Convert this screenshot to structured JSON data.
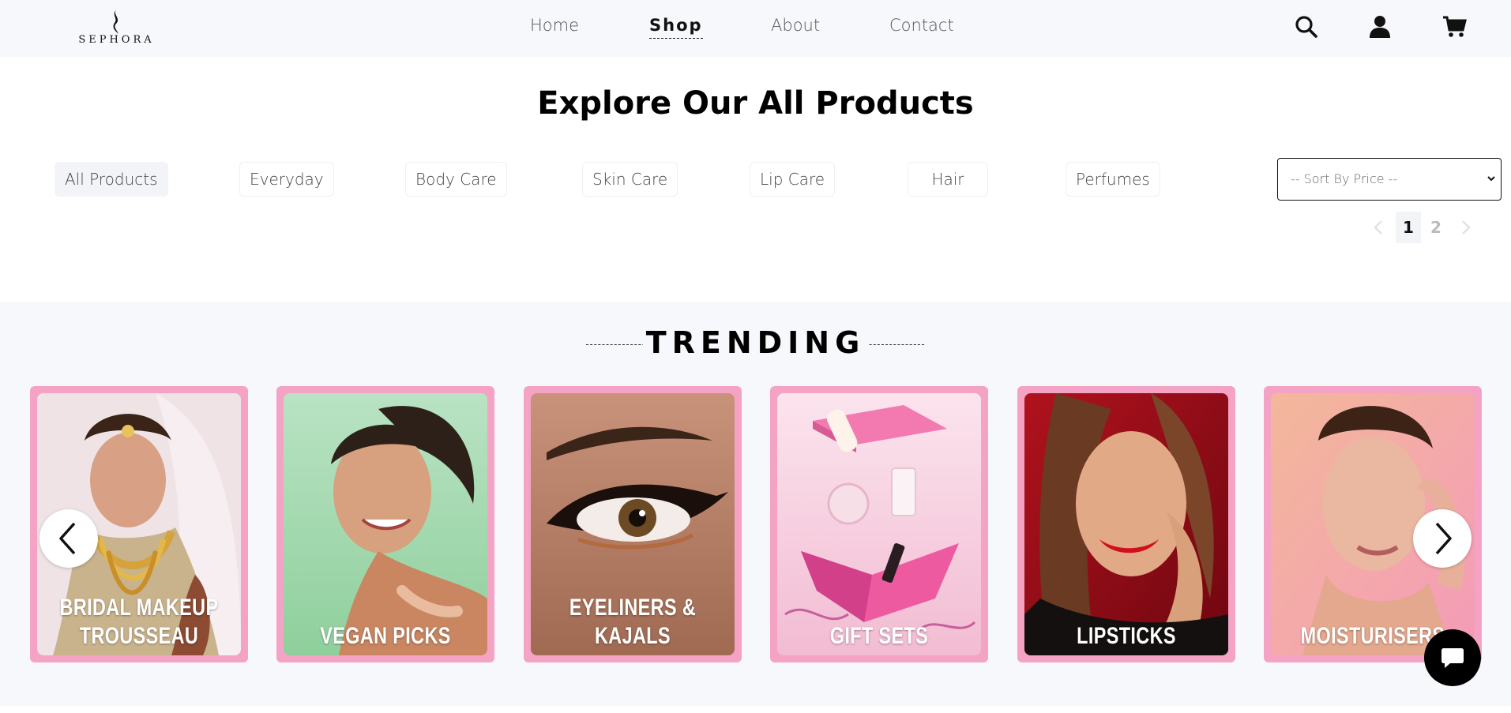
{
  "brand": {
    "name": "SEPHORA"
  },
  "nav": {
    "links": [
      {
        "label": "Home",
        "active": false
      },
      {
        "label": "Shop",
        "active": true
      },
      {
        "label": "About",
        "active": false
      },
      {
        "label": "Contact",
        "active": false
      }
    ],
    "icons": [
      "search-icon",
      "user-icon",
      "cart-icon"
    ]
  },
  "products": {
    "title": "Explore Our All Products",
    "filters": [
      "All Products",
      "Everyday",
      "Body Care",
      "Skin Care",
      "Lip Care",
      "Hair",
      "Perfumes"
    ],
    "active_filter": "All Products",
    "sort": {
      "selected": "-- Sort By Price --"
    },
    "pagination": {
      "pages": [
        "1",
        "2"
      ],
      "current": "1"
    }
  },
  "trending": {
    "title": "TRENDING",
    "cards": [
      {
        "label": "BRIDAL MAKEUP TROUSSEAU",
        "line1": "BRIDAL MAKEUP",
        "line2": "TROUSSEAU"
      },
      {
        "label": "VEGAN PICKS",
        "line1": "VEGAN PICKS",
        "line2": ""
      },
      {
        "label": "EYELINERS & KAJALS",
        "line1": "EYELINERS & KAJALS",
        "line2": ""
      },
      {
        "label": "GIFT SETS",
        "line1": "GIFT SETS",
        "line2": ""
      },
      {
        "label": "LIPSTICKS",
        "line1": "LIPSTICKS",
        "line2": ""
      },
      {
        "label": "MOISTURISERS",
        "line1": "MOISTURISERS",
        "line2": ""
      }
    ]
  },
  "colors": {
    "card_border": "#f5a3c5",
    "nav_bg": "#f7f8fc",
    "accent": "#000000"
  }
}
